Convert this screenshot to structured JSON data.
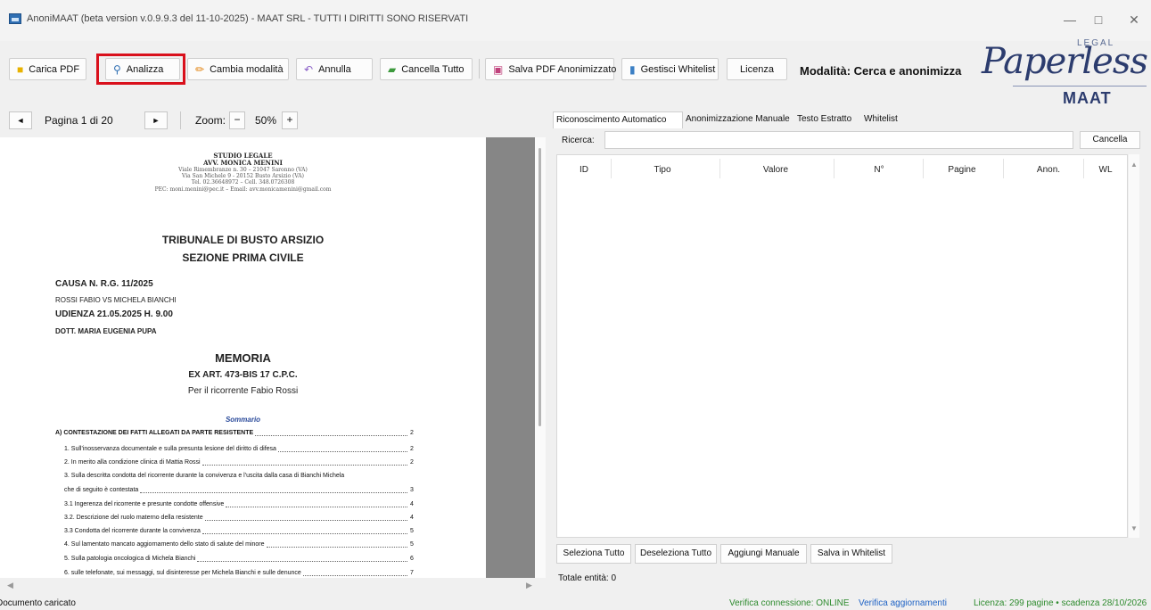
{
  "window": {
    "title": "AnoniMAAT (beta version v.0.9.9.3 del 11-10-2025) - MAAT SRL - TUTTI I DIRITTI SONO RISERVATI",
    "minimize": "—",
    "maximize": "□",
    "close": "✕"
  },
  "toolbar": {
    "carica_pdf": "Carica PDF",
    "analizza": "Analizza",
    "cambia_modalita": "Cambia modalità",
    "annulla": "Annulla",
    "cancella_tutto": "Cancella Tutto",
    "salva_pdf": "Salva PDF Anonimizzato",
    "gestisci_whitelist": "Gestisci Whitelist",
    "licenza": "Licenza",
    "mode_label": "Modalità: Cerca e anonimizza"
  },
  "logo": {
    "legal": "LEGAL",
    "main": "Paperless",
    "maat": "MAAT"
  },
  "nav": {
    "prev": "◄",
    "page_label": "Pagina 1 di 20",
    "next": "►",
    "zoom_label": "Zoom:",
    "zoom_minus": "−",
    "zoom_value": "50%",
    "zoom_plus": "+"
  },
  "document": {
    "studio": "STUDIO LEGALE",
    "avv": "AVV. MONICA MENINI",
    "addr1": "Viale Rimembranze n. 30 – 21047 Saronno (VA)",
    "addr2": "Via San Michele 9 - 20152 Busto Arsizio (VA)",
    "tel": "Tel. 02.36648972 – Cell. 348.0726308",
    "pec": "PEC: moni.menini@pec.it – Email: avv.monicamenini@gmail.com",
    "tribunale": "TRIBUNALE DI BUSTO ARSIZIO",
    "sezione": "SEZIONE PRIMA CIVILE",
    "causa": "CAUSA N. R.G. 11/2025",
    "parti": "ROSSI FABIO VS MICHELA BIANCHI",
    "udienza": "UDIENZA 21.05.2025 H. 9.00",
    "dott": "DOTT. MARIA EUGENIA PUPA",
    "memoria": "MEMORIA",
    "art": "EX ART. 473-BIS 17 C.P.C.",
    "ricorrente": "Per  il ricorrente Fabio Rossi",
    "sommario": "Sommario",
    "toc": [
      {
        "text": "A) CONTESTAZIONE DEI FATTI ALLEGATI DA PARTE RESISTENTE",
        "page": "2"
      },
      {
        "text": "1. Sull'inosservanza documentale e sulla presunta lesione del diritto di difesa",
        "page": "2"
      },
      {
        "text": "2. In merito alla condizione clinica di Mattia Rossi",
        "page": "2"
      },
      {
        "text": "3. Sulla descritta condotta del ricorrente durante la convivenza e l'uscita dalla casa di  Bianchi Michela",
        "page": ""
      },
      {
        "text": "che di seguito è contestata",
        "page": "3"
      },
      {
        "text": "3.1 Ingerenza del ricorrente e presunte condotte offensive",
        "page": "4"
      },
      {
        "text": "3.2. Descrizione del ruolo materno della resistente",
        "page": "4"
      },
      {
        "text": "3.3 Condotta del ricorrente durante la convivenza",
        "page": "5"
      },
      {
        "text": "4. Sul lamentato mancato aggiornamento dello stato di salute del minore",
        "page": "5"
      },
      {
        "text": "5. Sulla patologia oncologica di Michela Bianchi",
        "page": "6"
      },
      {
        "text": "6. sulle telefonate, sui messaggi, sul disinteresse per Michela Bianchi e sulle denunce",
        "page": "7"
      }
    ]
  },
  "tabs": {
    "auto": "Riconoscimento Automatico",
    "manual": "Anonimizzazione Manuale",
    "text": "Testo Estratto",
    "whitelist": "Whitelist"
  },
  "search": {
    "label": "Ricerca:",
    "value": "",
    "cancel": "Cancella"
  },
  "table": {
    "columns": [
      "ID",
      "Tipo",
      "Valore",
      "N°",
      "Pagine",
      "Anon.",
      "WL"
    ]
  },
  "bottom_buttons": {
    "select_all": "Seleziona Tutto",
    "deselect_all": "Deseleziona Tutto",
    "add_manual": "Aggiungi Manuale",
    "save_whitelist": "Salva in Whitelist"
  },
  "totale": "Totale entità: 0",
  "status": {
    "left": "Documento caricato",
    "connection": "Verifica connessione: ONLINE",
    "updates": "Verifica aggiornamenti",
    "license": "Licenza: 299 pagine • scadenza 28/10/2026"
  },
  "colors": {
    "highlight": "#d9101c",
    "status_green": "#2e8b2e",
    "status_link": "#1f63c5"
  },
  "icons": {
    "carica_pdf": "folder-icon",
    "analizza": "magnifier-icon",
    "cambia_modalita": "pencil-icon",
    "annulla": "undo-icon",
    "cancella_tutto": "trash-icon",
    "salva_pdf": "save-icon",
    "gestisci_whitelist": "notebook-icon"
  }
}
